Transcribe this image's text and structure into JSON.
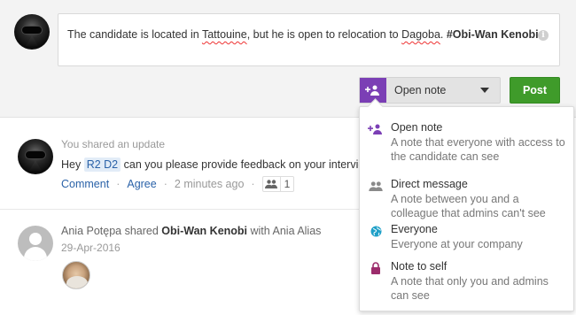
{
  "composer": {
    "text_prefix": "The candidate is located in ",
    "place1": "Tattouine",
    "text_middle": ", but he is open to relocation to ",
    "place2": "Dagoba",
    "text_period": ". ",
    "tag": "#Obi-Wan Kenobi",
    "info_icon": "i",
    "note_type": "Open note",
    "post_label": "Post"
  },
  "dropdown": {
    "options": [
      {
        "title": "Open note",
        "description": "A note that everyone with access to the candidate can see",
        "icon": "people-plus-icon",
        "color": "#7b3fb5"
      },
      {
        "title": "Direct message",
        "description": "A note between you and a colleague that admins can't see",
        "icon": "people-icon",
        "color": "#8a8a8a"
      },
      {
        "title": "Everyone",
        "description": "Everyone at your company",
        "icon": "globe-icon",
        "color": "#1fa0c8"
      },
      {
        "title": "Note to self",
        "description": "A note that only you and admins can see",
        "icon": "lock-icon",
        "color": "#9c2c6c"
      }
    ]
  },
  "feed": {
    "item1": {
      "meta": "You shared an update",
      "text_before": "Hey ",
      "mention": "R2 D2",
      "text_after": " can you please provide feedback on your interview",
      "comment_label": "Comment",
      "agree_label": "Agree",
      "dot": "·",
      "time": "2 minutes ago",
      "reaction_count": "1"
    },
    "item2": {
      "author": "Ania Potępa",
      "shared": " shared ",
      "subject": "Obi-Wan Kenobi",
      "with": " with Ania Alias",
      "date": "29-Apr-2016"
    }
  },
  "colors": {
    "accent": "#7b3fb5",
    "post": "#3f9b2a",
    "link": "#2a62a8"
  }
}
